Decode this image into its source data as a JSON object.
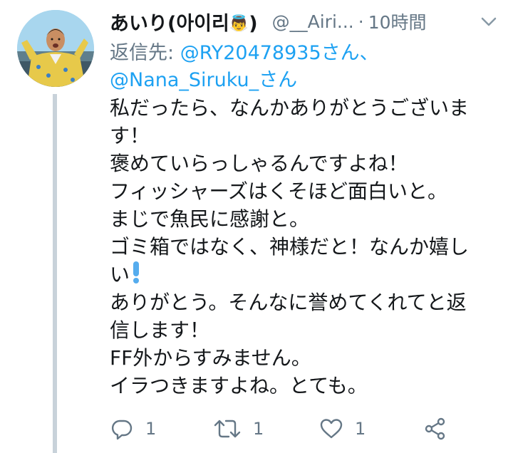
{
  "tweet": {
    "display_name": "あいり(아이리",
    "display_name_emoji": "👼",
    "display_name_close": ")",
    "handle": "@__Airi...",
    "separator": "·",
    "time": "10時間",
    "reply_prefix": "返信先: ",
    "reply_mention_1": "@RY20478935さん",
    "reply_joiner": "、",
    "reply_mention_2": "@Nana_Siruku_さん",
    "body_lines": [
      "私だったら、なんかありがとうございま",
      "す！",
      "褒めていらっしゃるんですよね！",
      "フィッシャーズはくそほど面白いと。",
      "まじで魚民に感謝と。",
      "ゴミ箱ではなく、神様だと！なんか嬉し",
      "い",
      "ありがとう。そんなに誉めてくれてと返",
      "信します！",
      "FF外からすみません。",
      "イラつきますよね。とても。"
    ],
    "body_emoji_after_line_7": "exclamation-emoji"
  },
  "actions": {
    "reply_count": "1",
    "retweet_count": "1",
    "like_count": "1"
  },
  "colors": {
    "accent": "#1da1f2",
    "secondary_text": "#657786",
    "text": "#14171a",
    "thread_line": "#c8d2da"
  }
}
